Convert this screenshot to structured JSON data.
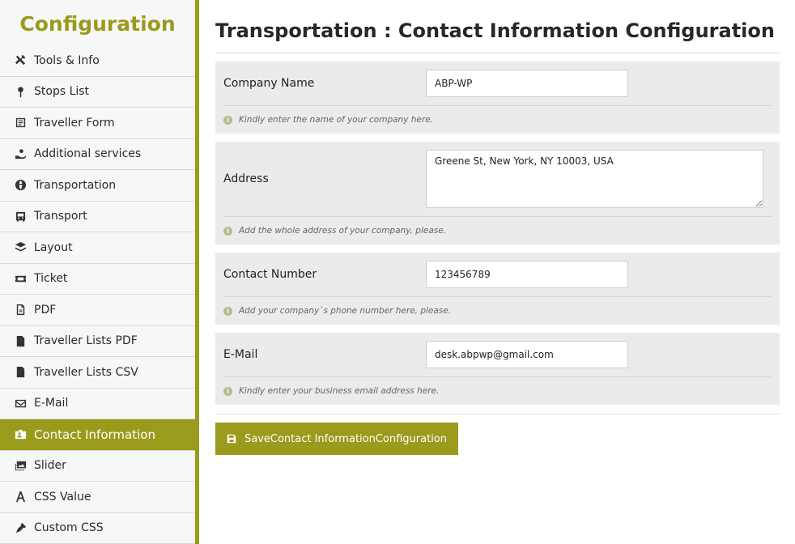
{
  "sidebar": {
    "title": "Configuration",
    "items": [
      {
        "label": "Tools & Info",
        "icon": "tools-icon"
      },
      {
        "label": "Stops List",
        "icon": "map-pin-icon"
      },
      {
        "label": "Traveller Form",
        "icon": "form-icon"
      },
      {
        "label": "Additional services",
        "icon": "hand-service-icon"
      },
      {
        "label": "Transportation",
        "icon": "globe-icon"
      },
      {
        "label": "Transport",
        "icon": "bus-icon"
      },
      {
        "label": "Layout",
        "icon": "layers-icon"
      },
      {
        "label": "Ticket",
        "icon": "ticket-icon"
      },
      {
        "label": "PDF",
        "icon": "pdf-file-icon"
      },
      {
        "label": "Traveller Lists PDF",
        "icon": "file-text-icon"
      },
      {
        "label": "Traveller Lists CSV",
        "icon": "csv-file-icon"
      },
      {
        "label": "E-Mail",
        "icon": "envelope-icon"
      },
      {
        "label": "Contact Information",
        "icon": "id-badge-icon",
        "active": true
      },
      {
        "label": "Slider",
        "icon": "images-icon"
      },
      {
        "label": "CSS Value",
        "icon": "css-value-icon"
      },
      {
        "label": "Custom CSS",
        "icon": "pen-nib-icon"
      }
    ]
  },
  "main": {
    "title": "Transportation : Contact Information Configuration",
    "fields": {
      "company": {
        "label": "Company Name",
        "value": "ABP-WP",
        "help": "Kindly enter the name of your company here."
      },
      "address": {
        "label": "Address",
        "value": "Greene St, New York, NY 10003, USA",
        "help": "Add the whole address of your company, please."
      },
      "phone": {
        "label": "Contact Number",
        "value": "123456789",
        "help": "Add your company`s phone number here, please."
      },
      "email": {
        "label": "E-Mail",
        "value": "desk.abpwp@gmail.com",
        "help": "Kindly enter your business email address here."
      }
    },
    "save_label": "SaveContact InformationConfiguration"
  },
  "colors": {
    "accent": "#9a9a1d",
    "card_bg": "#ebebeb",
    "sidebar_bg": "#f6f7f7"
  }
}
